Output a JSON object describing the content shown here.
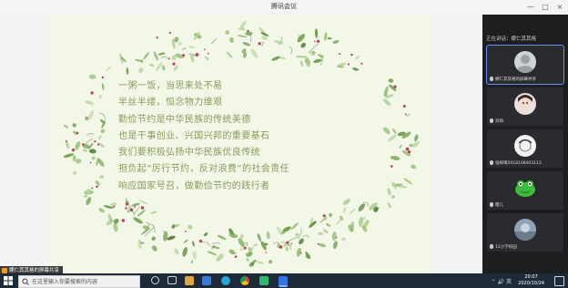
{
  "window": {
    "title": "腾讯会议",
    "minimize": "—",
    "maximize": "□",
    "close": "×"
  },
  "slide": {
    "lines": [
      "一粥一饭，当思来处不易",
      "半丝半缕，恒念物力维艰",
      "勤俭节约是中华民族的传统美德",
      "也是干事创业、兴国兴邦的重要基石",
      "我们要积极弘扬中华民族优良传统",
      "担负起“厉行节约，反对浪费”的社会责任",
      "响应国家号召，做勤俭节约的践行者"
    ]
  },
  "sharer_badge": "娜仁其其格的屏幕共享",
  "panel": {
    "speaking_label": "正在讲话：娜仁其其格",
    "participants": [
      {
        "name": "娜仁其其格的屏幕共享",
        "avatar_icon": "person-avatar-icon",
        "active": true
      },
      {
        "name": "刘琦",
        "avatar_icon": "anime-avatar-icon"
      },
      {
        "name": "张梓晴2018108403113",
        "avatar_icon": "sketch-avatar-icon"
      },
      {
        "name": "樱儿",
        "avatar_icon": "frog-avatar-icon"
      },
      {
        "name": "11小学校园",
        "avatar_icon": "photo-avatar-icon"
      }
    ]
  },
  "taskbar": {
    "search_placeholder": "在这里输入你要搜索的内容",
    "icons": [
      "task-view-icon",
      "file-explorer-icon",
      "store-icon",
      "edge-icon",
      "chrome-icon",
      "green-app-icon",
      "tencent-meeting-icon"
    ],
    "tray": "⌃ 🔊 英",
    "time": "20:07",
    "date": "2020/10/24"
  },
  "colors": {
    "poem_text": "#8a9a5b",
    "panel_bg": "#1d1e20",
    "taskbar_bg": "#1f2a38",
    "leaf_green": "#6f9f4a",
    "berry_red": "#b3455a"
  }
}
